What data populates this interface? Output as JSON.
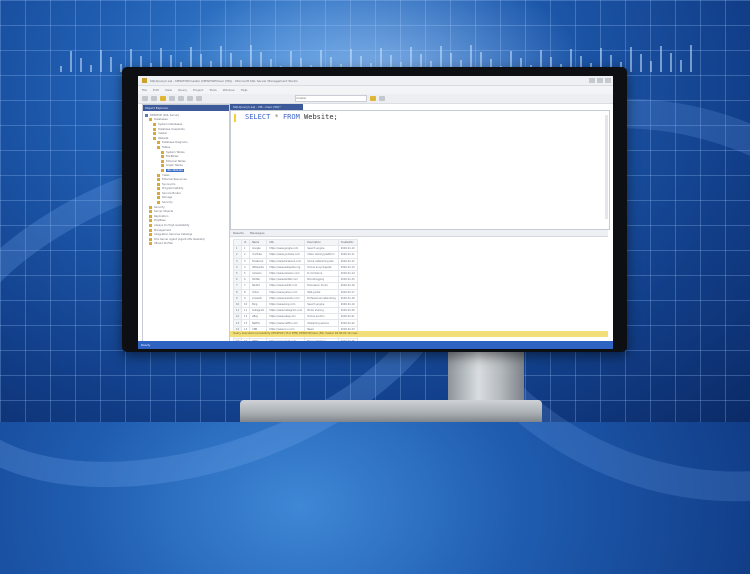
{
  "window": {
    "title": "SQLQuery1.sql - DESKTOP.master (DESKTOP\\User (56)) - Microsoft SQL Server Management Studio",
    "menu": [
      "File",
      "Edit",
      "View",
      "Query",
      "Project",
      "Tools",
      "Window",
      "Help"
    ],
    "database_selector": "master"
  },
  "object_explorer": {
    "title": "Object Explorer",
    "tree": [
      {
        "label": "DESKTOP (SQL Server)",
        "icon": "server-icon",
        "indent": 0
      },
      {
        "label": "Databases",
        "icon": "folder-icon",
        "indent": 1
      },
      {
        "label": "System Databases",
        "icon": "folder-icon",
        "indent": 2
      },
      {
        "label": "Database Snapshots",
        "icon": "folder-icon",
        "indent": 2
      },
      {
        "label": "master",
        "icon": "database-icon",
        "indent": 2
      },
      {
        "label": "Website",
        "icon": "database-icon",
        "indent": 2
      },
      {
        "label": "Database Diagrams",
        "icon": "folder-icon",
        "indent": 3
      },
      {
        "label": "Tables",
        "icon": "folder-icon",
        "indent": 3
      },
      {
        "label": "System Tables",
        "icon": "folder-icon",
        "indent": 4
      },
      {
        "label": "FileTables",
        "icon": "folder-icon",
        "indent": 4
      },
      {
        "label": "External Tables",
        "icon": "folder-icon",
        "indent": 4
      },
      {
        "label": "Graph Tables",
        "icon": "folder-icon",
        "indent": 4
      },
      {
        "label": "dbo.Website",
        "icon": "table-icon",
        "indent": 4,
        "selected": true
      },
      {
        "label": "Views",
        "icon": "folder-icon",
        "indent": 3
      },
      {
        "label": "External Resources",
        "icon": "folder-icon",
        "indent": 3
      },
      {
        "label": "Synonyms",
        "icon": "folder-icon",
        "indent": 3
      },
      {
        "label": "Programmability",
        "icon": "folder-icon",
        "indent": 3
      },
      {
        "label": "Service Broker",
        "icon": "folder-icon",
        "indent": 3
      },
      {
        "label": "Storage",
        "icon": "folder-icon",
        "indent": 3
      },
      {
        "label": "Security",
        "icon": "folder-icon",
        "indent": 3
      },
      {
        "label": "Security",
        "icon": "folder-icon",
        "indent": 1
      },
      {
        "label": "Server Objects",
        "icon": "folder-icon",
        "indent": 1
      },
      {
        "label": "Replication",
        "icon": "folder-icon",
        "indent": 1
      },
      {
        "label": "PolyBase",
        "icon": "folder-icon",
        "indent": 1
      },
      {
        "label": "Always On High Availability",
        "icon": "folder-icon",
        "indent": 1
      },
      {
        "label": "Management",
        "icon": "folder-icon",
        "indent": 1
      },
      {
        "label": "Integration Services Catalogs",
        "icon": "folder-icon",
        "indent": 1
      },
      {
        "label": "SQL Server Agent (Agent XPs disabled)",
        "icon": "folder-icon",
        "indent": 1
      },
      {
        "label": "XEvent Profiler",
        "icon": "folder-icon",
        "indent": 1
      }
    ]
  },
  "editor": {
    "tab_label": "SQLQuery1.sql - DE...User (56)*",
    "query": {
      "kw1": "SELECT",
      "star": "*",
      "kw2": "FROM",
      "table": "Website;"
    }
  },
  "results": {
    "tabs": [
      "Results",
      "Messages"
    ],
    "columns": [
      "",
      "Id",
      "Name",
      "URL",
      "Description",
      "CreatedOn"
    ],
    "rows": [
      [
        "1",
        "1",
        "Google",
        "https://www.google.com",
        "Search engine",
        "2020-01-10"
      ],
      [
        "2",
        "2",
        "YouTube",
        "https://www.youtube.com",
        "Video sharing platform",
        "2020-01-11"
      ],
      [
        "3",
        "3",
        "Facebook",
        "https://www.facebook.com",
        "Social networking site",
        "2020-01-12"
      ],
      [
        "4",
        "4",
        "Wikipedia",
        "https://www.wikipedia.org",
        "Online encyclopedia",
        "2020-01-13"
      ],
      [
        "5",
        "5",
        "Amazon",
        "https://www.amazon.com",
        "E-commerce",
        "2020-01-14"
      ],
      [
        "6",
        "6",
        "Twitter",
        "https://www.twitter.com",
        "Microblogging",
        "2020-01-15"
      ],
      [
        "7",
        "7",
        "Reddit",
        "https://www.reddit.com",
        "Discussion forum",
        "2020-01-16"
      ],
      [
        "8",
        "8",
        "Yahoo",
        "https://www.yahoo.com",
        "Web portal",
        "2020-01-17"
      ],
      [
        "9",
        "9",
        "LinkedIn",
        "https://www.linkedin.com",
        "Professional networking",
        "2020-01-18"
      ],
      [
        "10",
        "10",
        "Bing",
        "https://www.bing.com",
        "Search engine",
        "2020-01-19"
      ],
      [
        "11",
        "11",
        "Instagram",
        "https://www.instagram.com",
        "Photo sharing",
        "2020-01-20"
      ],
      [
        "12",
        "12",
        "eBay",
        "https://www.ebay.com",
        "Online auction",
        "2020-01-21"
      ],
      [
        "13",
        "13",
        "Netflix",
        "https://www.netflix.com",
        "Streaming service",
        "2020-01-22"
      ],
      [
        "14",
        "14",
        "CNN",
        "https://www.cnn.com",
        "News",
        "2020-01-23"
      ],
      [
        "15",
        "15",
        "Pinterest",
        "https://www.pinterest.com",
        "Image sharing",
        "2020-01-24"
      ],
      [
        "16",
        "16",
        "IMDb",
        "https://www.imdb.com",
        "Movie database",
        "2020-01-25"
      ]
    ],
    "status": "Query executed successfully.      DESKTOP (15.0 RTM)   DESKTOP\\User (56)   master   00:00:00   16 rows"
  },
  "statusbar": {
    "text": "Ready"
  },
  "colors": {
    "accent": "#2f63c2",
    "status_yellow": "#f3df7a",
    "keyword": "#3b63c7"
  }
}
